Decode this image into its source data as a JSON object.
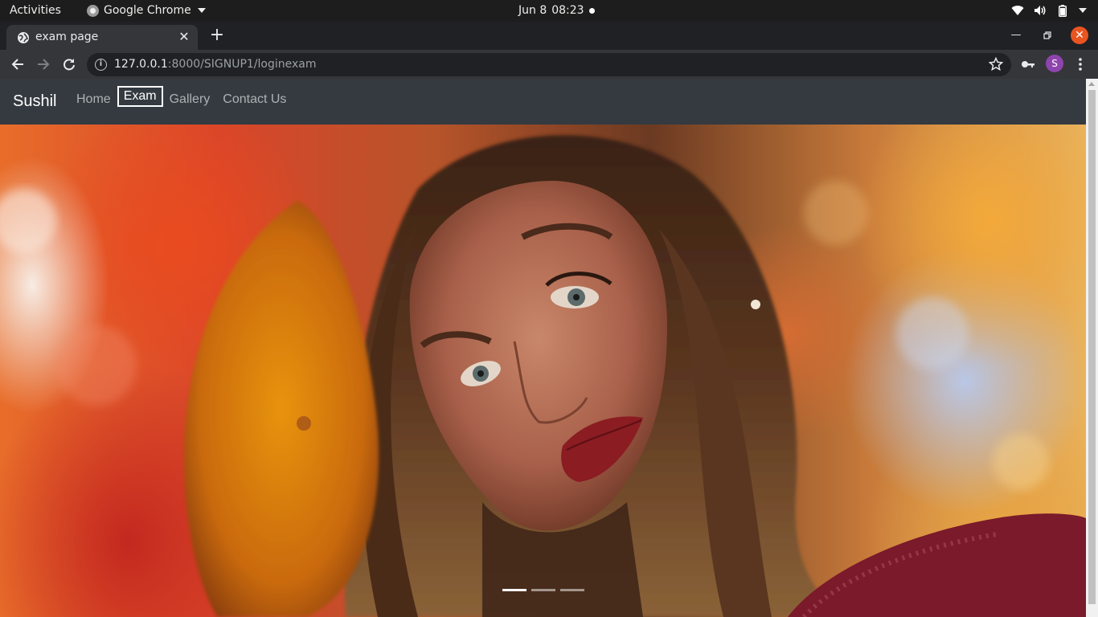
{
  "desktop": {
    "activities": "Activities",
    "app_name": "Google Chrome",
    "date": "Jun 8",
    "time": "08:23"
  },
  "browser": {
    "tab_title": "exam page",
    "url_host": "127.0.0.1",
    "url_path": ":8000/SIGNUP1/loginexam",
    "profile_initial": "S"
  },
  "page": {
    "brand": "Sushil",
    "nav": [
      {
        "label": "Home",
        "active": false
      },
      {
        "label": "Exam",
        "active": true
      },
      {
        "label": "Gallery",
        "active": false
      },
      {
        "label": "Contact Us",
        "active": false
      }
    ],
    "carousel": {
      "slides": 3,
      "active_index": 0
    }
  },
  "colors": {
    "navbar_bg": "#343a40",
    "accent_close": "#e95420",
    "avatar_bg": "#8e44ad"
  }
}
